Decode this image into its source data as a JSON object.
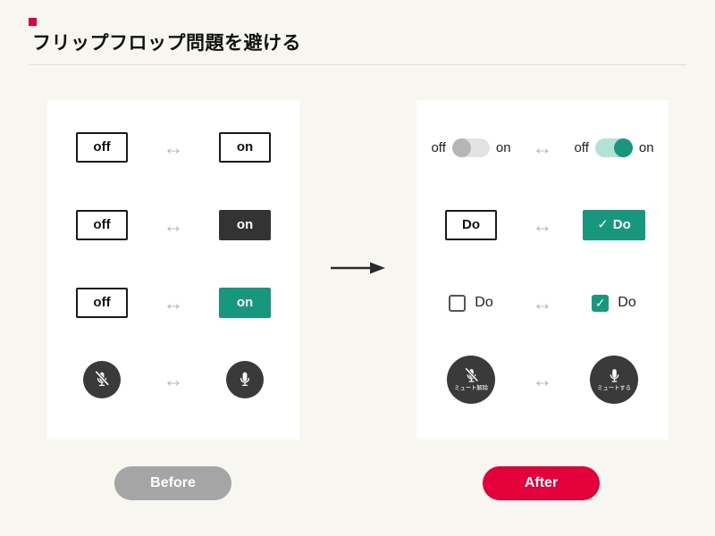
{
  "header": {
    "title": "フリップフロップ問題を避ける",
    "accent_color": "#e4003a"
  },
  "colors": {
    "background": "#f7f6f1",
    "panel": "#ffffff",
    "teal": "#17977e",
    "teal_light": "#b3e2d7",
    "dark": "#333333",
    "mic_circle": "#3a3a3a",
    "gray_pill": "#a5a5a5",
    "red_pill": "#e4003a",
    "arrow_gray": "#b5b5b5"
  },
  "swap_arrow_glyph": "↔",
  "before_panel": {
    "rows": [
      {
        "name": "outline-outline",
        "left": {
          "type": "button-outline",
          "label": "off"
        },
        "right": {
          "type": "button-outline",
          "label": "on"
        }
      },
      {
        "name": "outline-dark",
        "left": {
          "type": "button-outline",
          "label": "off"
        },
        "right": {
          "type": "button-dark",
          "label": "on"
        }
      },
      {
        "name": "outline-teal",
        "left": {
          "type": "button-outline",
          "label": "off"
        },
        "right": {
          "type": "button-teal",
          "label": "on"
        }
      },
      {
        "name": "mic-icons",
        "left": {
          "type": "mic-off-circle",
          "label": ""
        },
        "right": {
          "type": "mic-on-circle",
          "label": ""
        }
      }
    ]
  },
  "after_panel": {
    "rows": [
      {
        "name": "toggle-switch",
        "left": {
          "type": "switch-off",
          "label_left": "off",
          "label_right": "on"
        },
        "right": {
          "type": "switch-on",
          "label_left": "off",
          "label_right": "on"
        }
      },
      {
        "name": "do-buttons",
        "left": {
          "type": "button-outline",
          "label": "Do"
        },
        "right": {
          "type": "button-teal",
          "label": "Do",
          "check": "✓"
        }
      },
      {
        "name": "checkboxes",
        "left": {
          "type": "checkbox-empty",
          "label": "Do"
        },
        "right": {
          "type": "checkbox-checked",
          "label": "Do",
          "check": "✓"
        }
      },
      {
        "name": "mic-labeled",
        "left": {
          "type": "mic-off-circle",
          "label": "ミュート解除"
        },
        "right": {
          "type": "mic-on-circle",
          "label": "ミュートする"
        }
      }
    ]
  },
  "pills": {
    "before": "Before",
    "after": "After"
  }
}
